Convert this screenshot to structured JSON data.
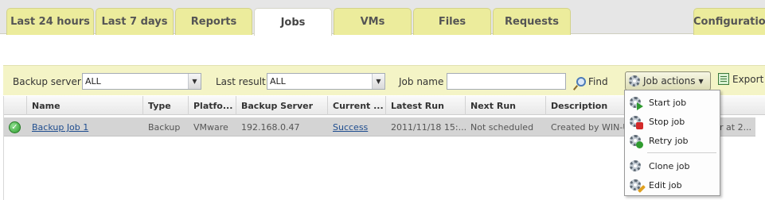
{
  "tabs": [
    {
      "label": "Last 24 hours",
      "active": false
    },
    {
      "label": "Last 7 days",
      "active": false
    },
    {
      "label": "Reports",
      "active": false
    },
    {
      "label": "Jobs",
      "active": true
    },
    {
      "label": "VMs",
      "active": false
    },
    {
      "label": "Files",
      "active": false
    },
    {
      "label": "Requests",
      "active": false
    },
    {
      "label": "Configuration",
      "active": false
    }
  ],
  "toolbar": {
    "backup_server_label": "Backup server",
    "backup_server_value": "ALL",
    "last_result_label": "Last result",
    "last_result_value": "ALL",
    "job_name_label": "Job name",
    "job_name_value": "",
    "find_label": "Find",
    "job_actions_label": "Job actions",
    "export_label": "Export"
  },
  "grid": {
    "columns": [
      "Name",
      "Type",
      "Platfo...",
      "Backup Server",
      "Current ...",
      "Latest Run",
      "Next Run",
      "Description"
    ],
    "rows": [
      {
        "status_icon": "success-check-icon",
        "name": "Backup Job 1",
        "type": "Backup",
        "platform": "VMware",
        "backup_server": "192.168.0.47",
        "current_status": "Success",
        "latest_run": "2011/11/18 15:...",
        "next_run": "Not scheduled",
        "description": "Created by WIN-UC",
        "description_tail": "r at 2..."
      }
    ]
  },
  "job_actions_menu": {
    "items": [
      {
        "label": "Start job",
        "icon": "start-job-icon"
      },
      {
        "label": "Stop job",
        "icon": "stop-job-icon"
      },
      {
        "label": "Retry job",
        "icon": "retry-job-icon"
      },
      {
        "label": "Clone job",
        "icon": "clone-job-icon"
      },
      {
        "label": "Edit job",
        "icon": "edit-job-icon"
      }
    ]
  },
  "colors": {
    "tab_bg": "#ecec9c",
    "toolbar_bg": "#f4f4c6",
    "selected_row": "#d4d4d4",
    "link": "#1f4d8f"
  }
}
